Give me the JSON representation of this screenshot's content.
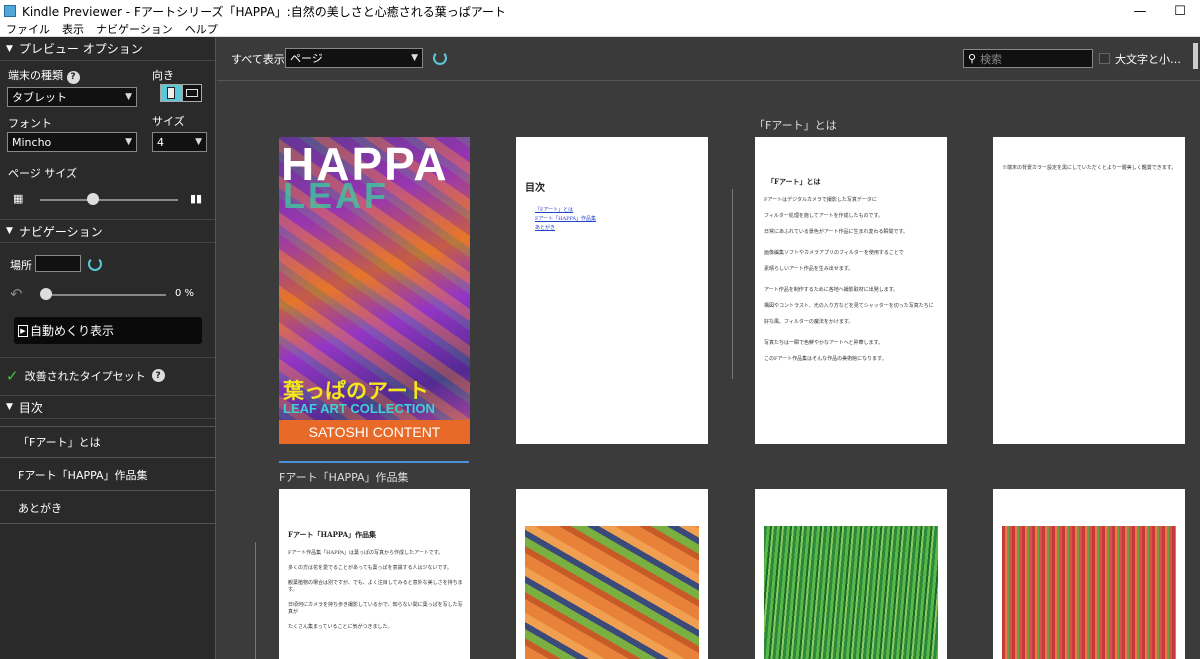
{
  "window": {
    "title": "Kindle Previewer - Fアートシリーズ「HAPPA」:自然の美しさと心癒される葉っぱアート",
    "min": "—",
    "max": "☐"
  },
  "menu": [
    "ファイル",
    "表示",
    "ナビゲーション",
    "ヘルプ"
  ],
  "sidebar": {
    "preview_options": "プレビュー オプション",
    "device_type_label": "端末の種類",
    "device_type_value": "タブレット",
    "orientation_label": "向き",
    "font_label": "フォント",
    "font_value": "Mincho",
    "size_label": "サイズ",
    "size_value": "4",
    "page_size_label": "ページ サイズ",
    "navigation": "ナビゲーション",
    "location_label": "場所",
    "progress_percent": "0 %",
    "auto_flip": "自動めくり表示",
    "typeset": "改善されたタイプセット",
    "toc": "目次",
    "toc_items": [
      "「Fアート」とは",
      "Fアート「HAPPA」作品集",
      "あとがき"
    ]
  },
  "toolbar": {
    "show_all_label": "すべて表示",
    "view_value": "ページ",
    "search_placeholder": "検索",
    "match_case": "大文字と小…"
  },
  "sections": {
    "s1": "「Fアート」とは",
    "s2": "Fアート「HAPPA」作品集"
  },
  "cover": {
    "title": "HAPPA",
    "subtitle": "LEAF",
    "jp_title": "葉っぱのアート",
    "en_title": "LEAF ART COLLECTION",
    "author": "SATOSHI CONTENT"
  },
  "toc_page": {
    "title": "目次",
    "links": [
      "「Fアート」とは",
      "Fアート「HAPPA」作品集",
      "あとがき"
    ]
  },
  "page3": {
    "title": "「Fアート」とは",
    "lines": [
      "Fアートはデジタルカメラで撮影した写真データに",
      "フィルター処理を施してアートを作成したものです。",
      "日常にあふれている景色がアート作品に生まれ変わる瞬間です。",
      "画像編集ソフトやカメラアプリのフィルターを使用することで",
      "素晴らしいアート作品を生み出せます。",
      "アート作品を制作するために各地へ撮影取材に出発します。",
      "構図やコントラスト、光の入り方などを見てシャッターを切った写真たちに",
      "好な風、フィルターの魔法をかけます。",
      "写真たちは一瞬で色鮮やかなアートへと昇華します。",
      "このFアート作品集はそんな作品の美術館になります。"
    ]
  },
  "page4": {
    "note": "※端末の背景カラー設定を黒にしていただくとより一層美しく鑑賞できます。"
  },
  "page5": {
    "title": "Fアート「HAPPA」作品集",
    "lines": [
      "Fアート作品集「HAPPA」は葉っぱの写真から作成したアートです。",
      "多くの方は花を愛でることがあっても葉っぱを意識する人は少ないです。",
      "観葉植物の場合は別ですが、でも、よく注目してみると意外な美しさを持ちます。",
      "日頃何にカメラを持ち歩き撮影しているかで、知らない間に葉っぱを写した写真が",
      "たくさん集まっていることに気がつきました。"
    ]
  }
}
